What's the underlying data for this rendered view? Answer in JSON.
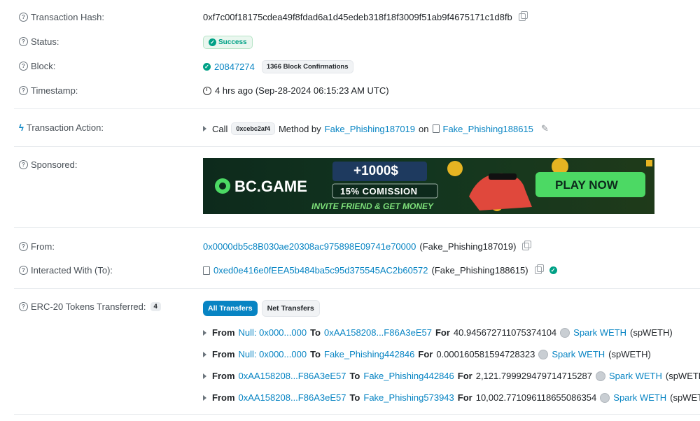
{
  "rows": {
    "tx_hash": {
      "label": "Transaction Hash:",
      "value": "0xf7c00f18175cdea49f8fdad6a1d45edeb318f18f3009f51ab9f4675171c1d8fb"
    },
    "status": {
      "label": "Status:",
      "value": "Success"
    },
    "block": {
      "label": "Block:",
      "number": "20847274",
      "confirmations": "1366 Block Confirmations"
    },
    "timestamp": {
      "label": "Timestamp:",
      "value": "4 hrs ago (Sep-28-2024 06:15:23 AM UTC)"
    },
    "action": {
      "label": "Transaction Action:",
      "call": "Call",
      "method_chip": "0xcebc2af4",
      "method_by": "Method by",
      "caller": "Fake_Phishing187019",
      "on": "on",
      "target": "Fake_Phishing188615"
    },
    "sponsored": {
      "label": "Sponsored:"
    },
    "from": {
      "label": "From:",
      "address": "0x0000db5c8B030ae20308ac975898E09741e70000",
      "name": "(Fake_Phishing187019)"
    },
    "to": {
      "label": "Interacted With (To):",
      "address": "0xed0e416e0fEEA5b484ba5c95d375545AC2b60572",
      "name": "(Fake_Phishing188615)"
    },
    "erc20": {
      "label": "ERC-20 Tokens Transferred:",
      "count": "4"
    }
  },
  "banner": {
    "brand": "BC.GAME",
    "amount": "+1000$",
    "commission": "15% COMISSION",
    "tagline": "INVITE FRIEND & GET MONEY",
    "cta": "PLAY NOW"
  },
  "tabs": {
    "all": "All Transfers",
    "net": "Net Transfers"
  },
  "transfers": [
    {
      "from_label": "From",
      "from": "Null: 0x000...000",
      "to_label": "To",
      "to": "0xAA158208...F86A3eE57",
      "for_label": "For",
      "amount": "40.945672711075374104",
      "token": "Spark WETH",
      "symbol": "(spWETH)"
    },
    {
      "from_label": "From",
      "from": "Null: 0x000...000",
      "to_label": "To",
      "to": "Fake_Phishing442846",
      "for_label": "For",
      "amount": "0.000160581594728323",
      "token": "Spark WETH",
      "symbol": "(spWETH)"
    },
    {
      "from_label": "From",
      "from": "0xAA158208...F86A3eE57",
      "to_label": "To",
      "to": "Fake_Phishing442846",
      "for_label": "For",
      "amount": "2,121.799929479714715287",
      "token": "Spark WETH",
      "symbol": "(spWETH)"
    },
    {
      "from_label": "From",
      "from": "0xAA158208...F86A3eE57",
      "to_label": "To",
      "to": "Fake_Phishing573943",
      "for_label": "For",
      "amount": "10,002.771096118655086354",
      "token": "Spark WETH",
      "symbol": "(spWETH)"
    }
  ],
  "colors": {
    "link": "#0784c3",
    "success": "#00a186",
    "banner_bg": "#0f2a1e",
    "cta": "#4cd964"
  }
}
